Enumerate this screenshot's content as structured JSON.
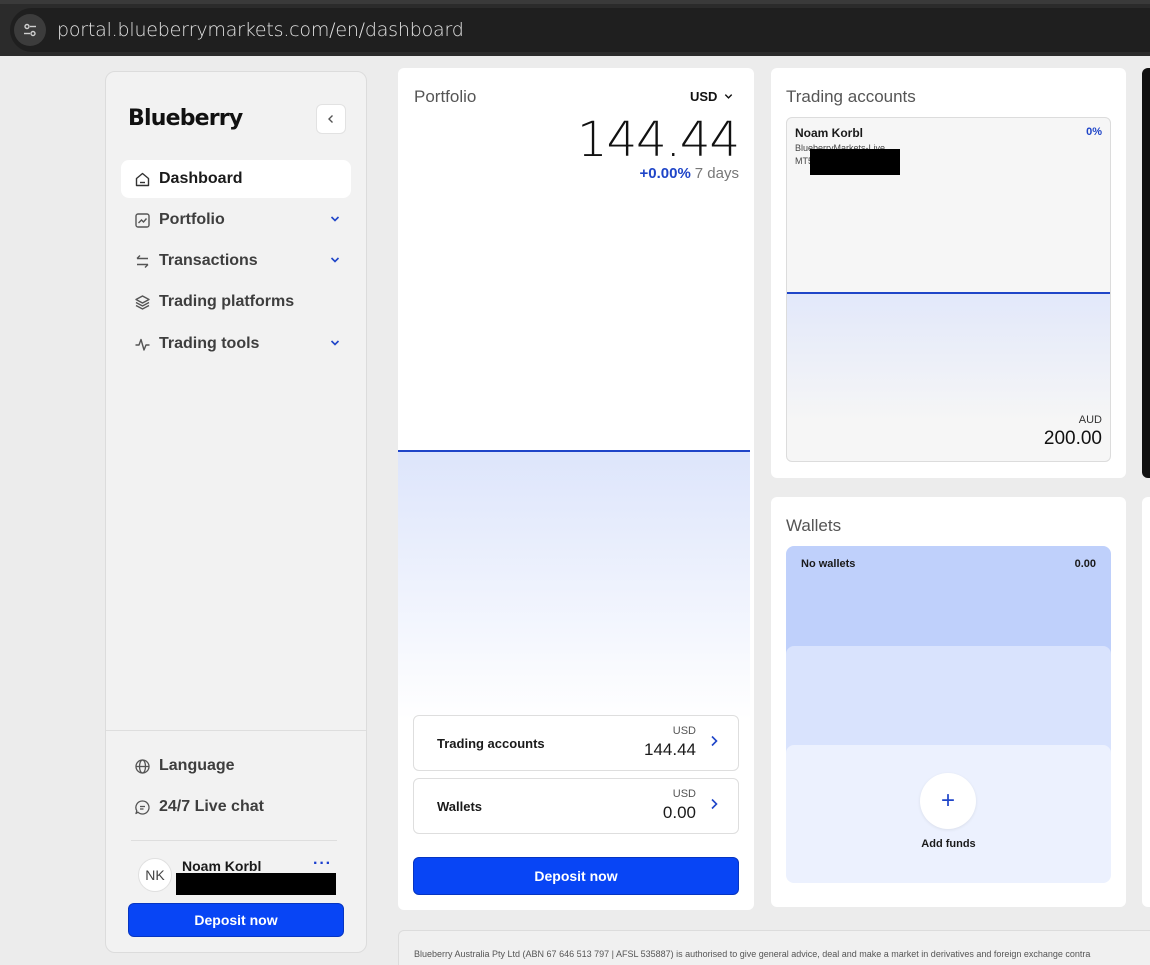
{
  "browser": {
    "url": "portal.blueberrymarkets.com/en/dashboard"
  },
  "sidebar": {
    "logo": "Blueberry",
    "items": [
      {
        "label": "Dashboard"
      },
      {
        "label": "Portfolio"
      },
      {
        "label": "Transactions"
      },
      {
        "label": "Trading platforms"
      },
      {
        "label": "Trading tools"
      }
    ],
    "language": "Language",
    "live_chat": "24/7 Live chat",
    "user": {
      "initials": "NK",
      "name": "Noam Korbl",
      "menu": "···"
    },
    "deposit": "Deposit now"
  },
  "portfolio": {
    "title": "Portfolio",
    "currency": "USD",
    "value": "144.44",
    "change_pct": "+0.00%",
    "change_period": "7 days",
    "rows": [
      {
        "label": "Trading accounts",
        "currency": "USD",
        "value": "144.44"
      },
      {
        "label": "Wallets",
        "currency": "USD",
        "value": "0.00"
      }
    ],
    "deposit": "Deposit now"
  },
  "trading_accounts": {
    "title": "Trading accounts",
    "account": {
      "name": "Noam Korbl",
      "server": "BlueberryMarkets-Live",
      "platform": "MT5",
      "change": "0%",
      "currency": "AUD",
      "balance": "200.00"
    }
  },
  "wallets": {
    "title": "Wallets",
    "empty_label": "No wallets",
    "empty_value": "0.00",
    "add_icon": "+",
    "add_label": "Add funds"
  },
  "footer": {
    "text": "Blueberry Australia Pty Ltd (ABN 67 646 513 797 | AFSL 535887) is authorised to give general advice, deal and make a market in derivatives and foreign exchange contra"
  }
}
